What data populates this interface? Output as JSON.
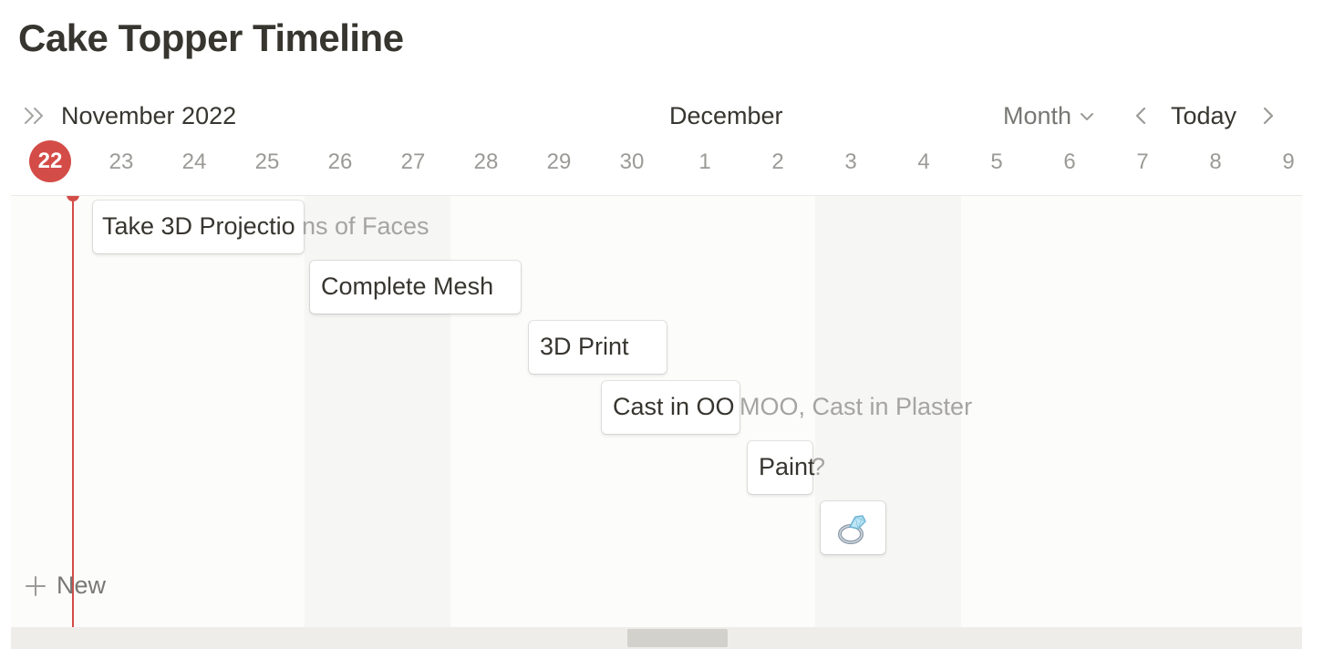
{
  "page": {
    "title": "Cake Topper Timeline"
  },
  "toolbar": {
    "current_month": "November 2022",
    "next_month": "December",
    "view_mode": "Month",
    "today_label": "Today"
  },
  "days": {
    "today": "22",
    "labels": [
      "23",
      "24",
      "25",
      "26",
      "27",
      "28",
      "29",
      "30",
      "1",
      "2",
      "3",
      "4",
      "5",
      "6",
      "7",
      "8",
      "9"
    ]
  },
  "tasks": [
    {
      "visible": "Take 3D Projectio",
      "overflow": "ns of Faces",
      "full_title": "Take 3D Projections of Faces"
    },
    {
      "visible": "Complete Mesh",
      "overflow": "",
      "full_title": "Complete Mesh"
    },
    {
      "visible": "3D Print",
      "overflow": "",
      "full_title": "3D Print"
    },
    {
      "visible": "Cast in OO",
      "overflow": "MOO, Cast in Plaster",
      "full_title": "Cast in OOMOO, Cast in Plaster"
    },
    {
      "visible": "Paint",
      "overflow": "?",
      "full_title": "Paint?"
    },
    {
      "visible": "",
      "overflow": "",
      "icon": "ring-icon"
    }
  ],
  "actions": {
    "new_label": "New"
  },
  "colors": {
    "accent_red": "#d44c47",
    "text": "#37352f",
    "muted": "#9b9a97"
  }
}
